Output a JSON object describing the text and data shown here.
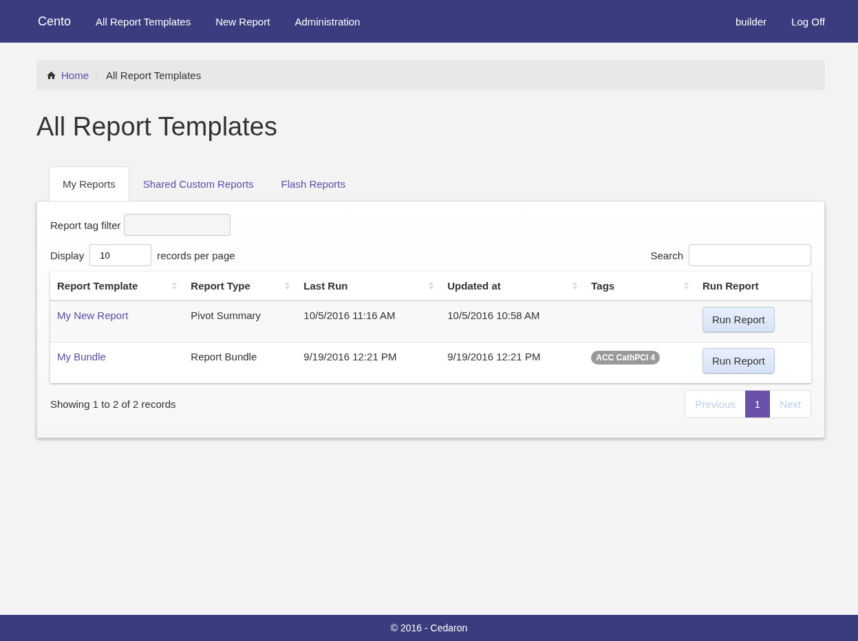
{
  "navbar": {
    "brand": "Cento",
    "links": [
      "All Report Templates",
      "New Report",
      "Administration"
    ],
    "right_links": [
      "builder",
      "Log Off"
    ]
  },
  "breadcrumb": {
    "home": "Home",
    "current": "All Report Templates"
  },
  "title": "All Report Templates",
  "tabs": [
    {
      "label": "My Reports",
      "selected": true
    },
    {
      "label": "Shared Custom Reports",
      "selected": false
    },
    {
      "label": "Flash Reports",
      "selected": false
    }
  ],
  "tag_filter": {
    "label": "Report tag filter"
  },
  "display": {
    "label": "Display",
    "value": "10",
    "suffix": "records per page"
  },
  "search": {
    "label": "Search"
  },
  "table": {
    "columns": [
      {
        "label": "Report Template",
        "sortable": true
      },
      {
        "label": "Report Type",
        "sortable": true
      },
      {
        "label": "Last Run",
        "sortable": true
      },
      {
        "label": "Updated at",
        "sortable": true
      },
      {
        "label": "Tags",
        "sortable": true
      },
      {
        "label": "Run Report",
        "sortable": false
      }
    ],
    "rows": [
      {
        "name": "My New Report",
        "type": "Pivot Summary",
        "last_run": "10/5/2016 11:16 AM",
        "updated": "10/5/2016 10:58 AM",
        "tags": [],
        "action": "Run Report"
      },
      {
        "name": "My Bundle",
        "type": "Report Bundle",
        "last_run": "9/19/2016 12:21 PM",
        "updated": "9/19/2016 12:21 PM",
        "tags": [
          "ACC CathPCI 4"
        ],
        "action": "Run Report"
      }
    ]
  },
  "info": "Showing 1 to 2 of 2 records",
  "pagination": [
    {
      "label": "Previous",
      "disabled": true,
      "selected": false
    },
    {
      "label": "1",
      "disabled": false,
      "selected": true
    },
    {
      "label": "Next",
      "disabled": true,
      "selected": false
    }
  ],
  "footer": "© 2016 - Cedaron"
}
